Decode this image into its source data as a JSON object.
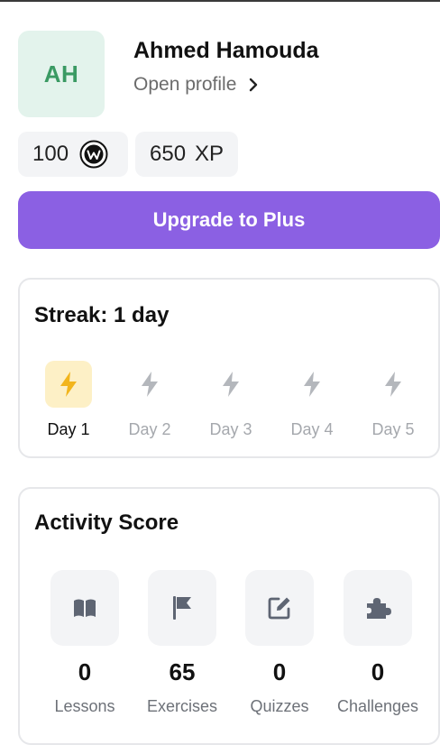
{
  "profile": {
    "initials": "AH",
    "name": "Ahmed Hamouda",
    "open_profile_label": "Open profile"
  },
  "stats": {
    "coins": "100",
    "xp_value": "650",
    "xp_unit": "XP"
  },
  "upgrade": {
    "label": "Upgrade to Plus"
  },
  "streak": {
    "title": "Streak: 1 day",
    "days": [
      {
        "label": "Day 1",
        "active": true
      },
      {
        "label": "Day 2",
        "active": false
      },
      {
        "label": "Day 3",
        "active": false
      },
      {
        "label": "Day 4",
        "active": false
      },
      {
        "label": "Day 5",
        "active": false
      }
    ]
  },
  "activity": {
    "title": "Activity Score",
    "items": [
      {
        "label": "Lessons",
        "value": "0",
        "icon": "book-icon"
      },
      {
        "label": "Exercises",
        "value": "65",
        "icon": "flag-icon"
      },
      {
        "label": "Quizzes",
        "value": "0",
        "icon": "edit-icon"
      },
      {
        "label": "Challenges",
        "value": "0",
        "icon": "puzzle-icon"
      }
    ]
  },
  "colors": {
    "accent": "#8b60e3",
    "avatar_bg": "#e3f3ec",
    "avatar_text": "#3a9a63",
    "bolt_active": "#f2b51c",
    "bolt_inactive": "#b4b7bc",
    "activity_icon": "#5e6573"
  }
}
